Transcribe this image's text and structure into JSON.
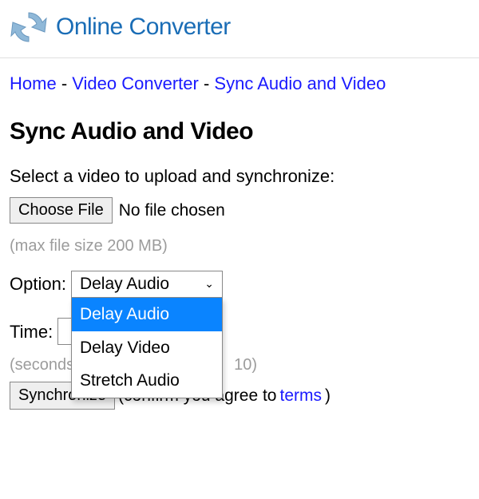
{
  "site": {
    "title": "Online Converter"
  },
  "breadcrumb": {
    "home": "Home",
    "sep": "-",
    "videoConverter": "Video Converter",
    "current": "Sync Audio and Video"
  },
  "page": {
    "heading": "Sync Audio and Video",
    "instruction": "Select a video to upload and synchronize:"
  },
  "file": {
    "buttonLabel": "Choose File",
    "status": "No file chosen",
    "hint": "(max file size 200 MB)"
  },
  "option": {
    "label": "Option:",
    "selected": "Delay Audio",
    "options": [
      "Delay Audio",
      "Delay Video",
      "Stretch Audio"
    ]
  },
  "time": {
    "label": "Time:",
    "value": "",
    "unitTrail": "ds",
    "hint": "(seconds",
    "hintTrail": "10)"
  },
  "action": {
    "submitLabel": "Synchronize",
    "confirmPrefix": "(confirm you agree to",
    "termsLabel": "terms",
    "confirmSuffix": ")"
  }
}
